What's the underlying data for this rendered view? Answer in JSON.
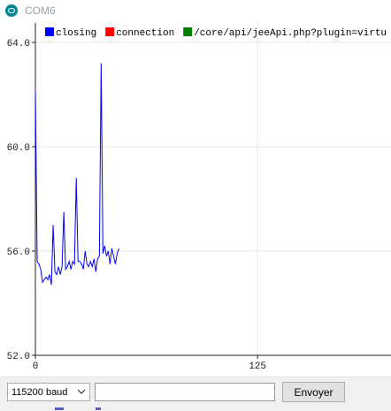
{
  "window": {
    "title": "COM6",
    "icon": "arduino-icon"
  },
  "chart_data": {
    "type": "line",
    "x": [
      0,
      1,
      2,
      3,
      4,
      5,
      6,
      7,
      8,
      9,
      10,
      11,
      12,
      13,
      14,
      15,
      16,
      17,
      18,
      19,
      20,
      21,
      22,
      23,
      24,
      25,
      26,
      27,
      28,
      29,
      30,
      31,
      32,
      33,
      34,
      35,
      36,
      37,
      38,
      39,
      40,
      41,
      42,
      43,
      44,
      45,
      46,
      47
    ],
    "series": [
      {
        "name": "closing",
        "color": "#0000ff",
        "values": [
          62.2,
          55.6,
          55.5,
          55.3,
          54.8,
          54.9,
          55.0,
          54.9,
          55.1,
          54.7,
          57.0,
          55.2,
          55.1,
          55.4,
          55.1,
          55.4,
          57.5,
          55.3,
          55.4,
          55.6,
          55.3,
          55.6,
          55.5,
          58.8,
          55.6,
          55.6,
          55.5,
          55.3,
          56.0,
          55.5,
          55.4,
          55.6,
          55.4,
          55.7,
          55.2,
          55.7,
          55.8,
          63.2,
          55.9,
          56.2,
          55.8,
          56.0,
          55.5,
          56.1,
          55.8,
          55.5,
          55.9,
          56.1
        ]
      },
      {
        "name": "connection",
        "color": "#ff0000",
        "values": []
      },
      {
        "name": "/core/api/jeeApi.php?plugin=virtu",
        "color": "#008000",
        "values": []
      }
    ],
    "y_ticks": [
      "64.0",
      "60.0",
      "56.0",
      "52.0"
    ],
    "x_ticks": [
      "0",
      "125"
    ],
    "ylim": [
      52,
      64
    ],
    "xlim": [
      0,
      219
    ],
    "grid": true,
    "legend_position": "top-left"
  },
  "controls": {
    "baud_value": "115200 baud",
    "send_input_value": "",
    "send_label": "Envoyer"
  }
}
